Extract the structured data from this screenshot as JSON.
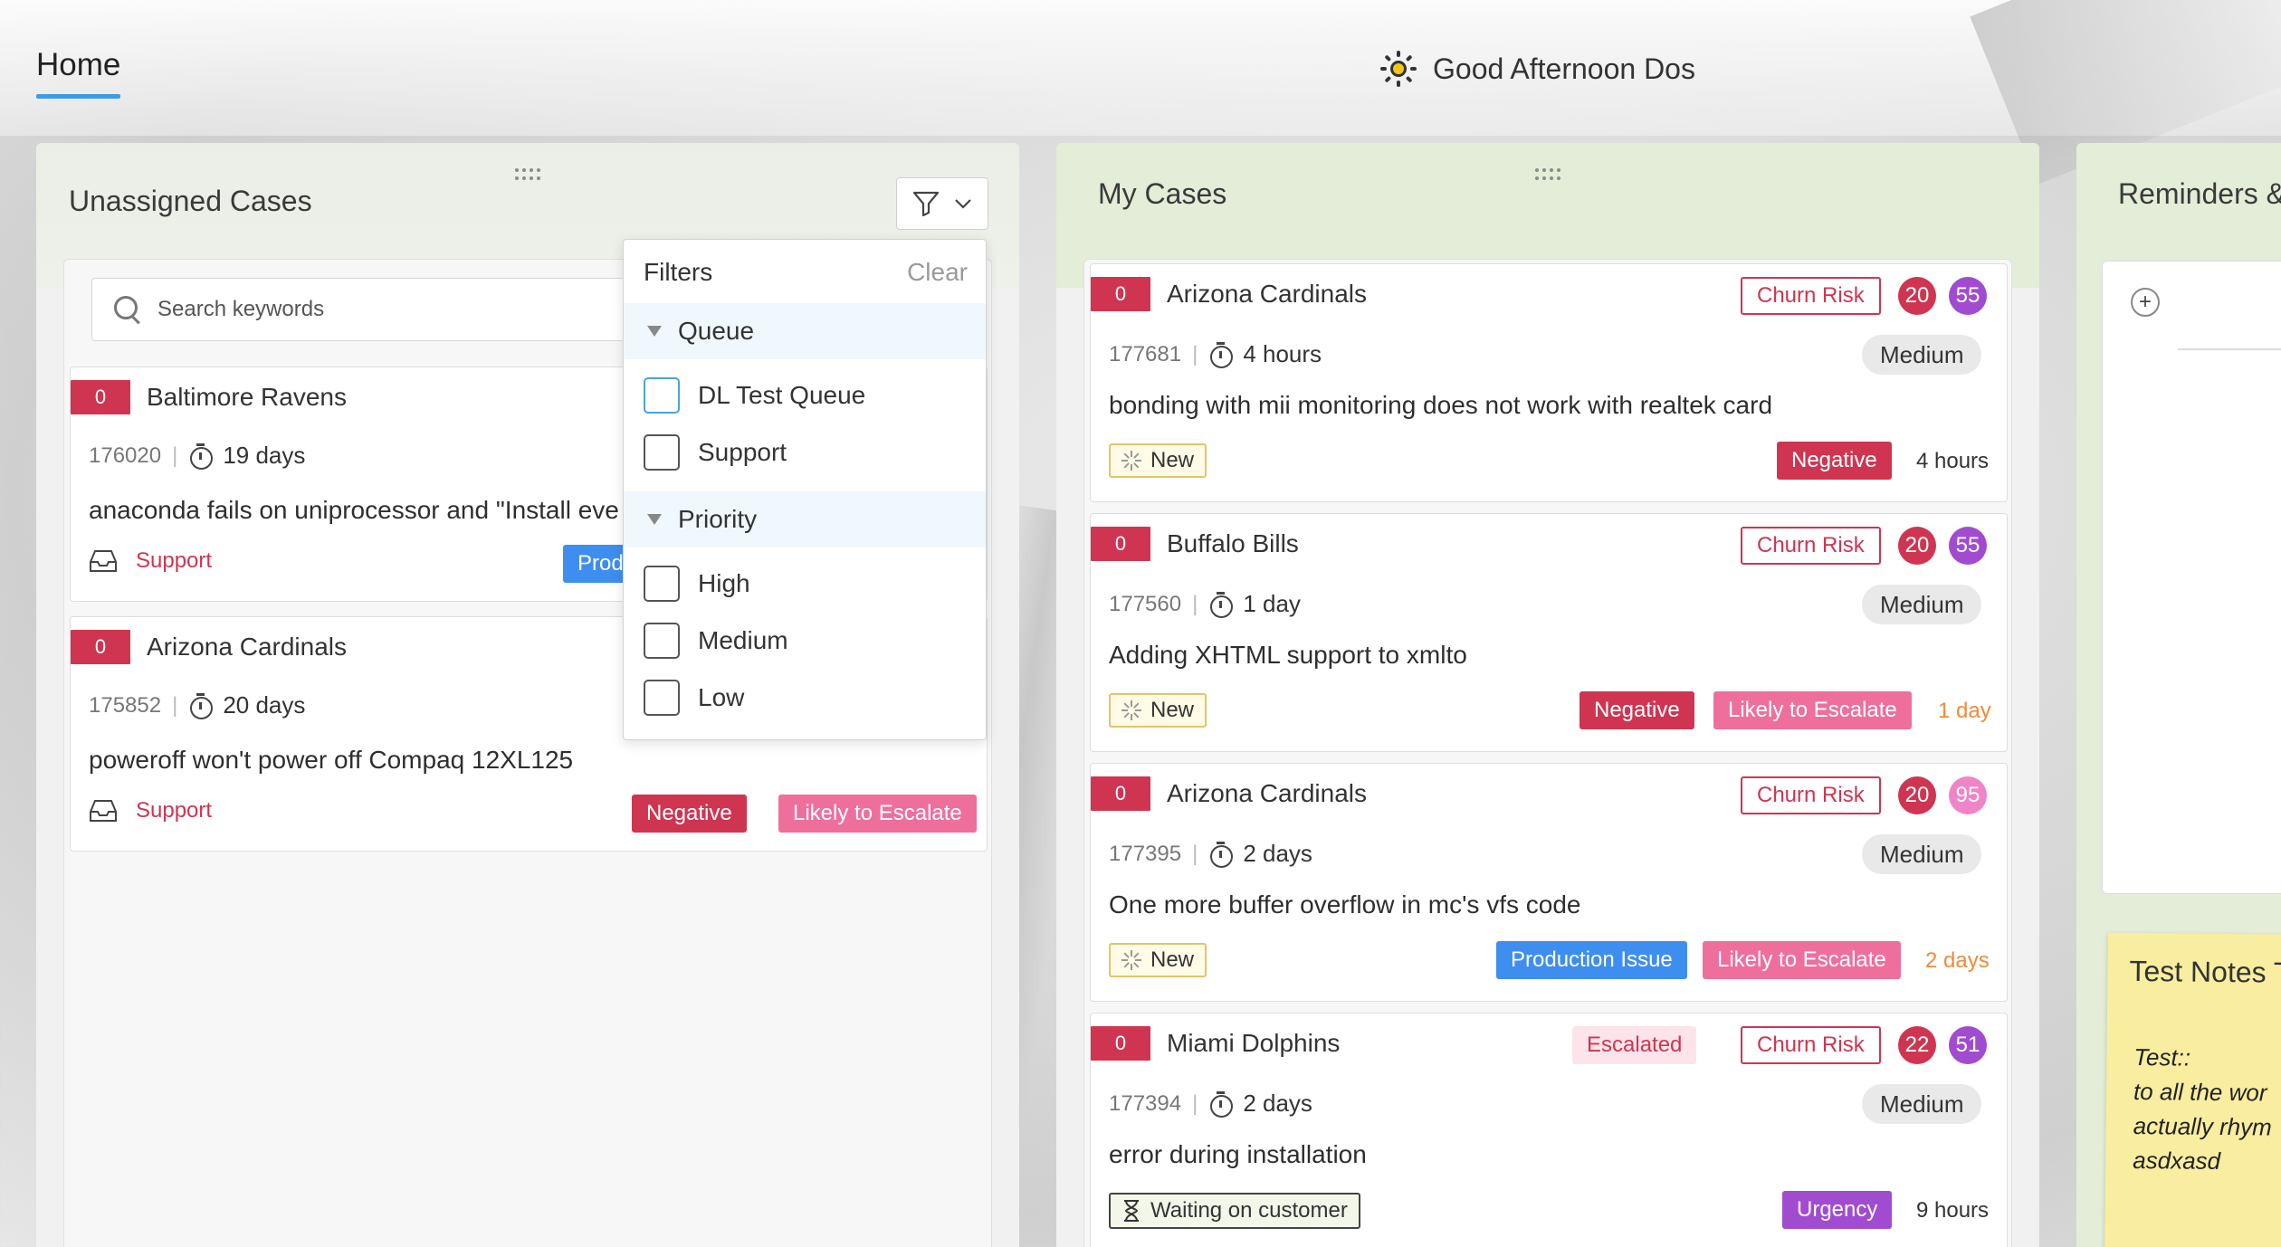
{
  "header": {
    "home_tab": "Home",
    "greeting": "Good Afternoon Dos"
  },
  "unassigned": {
    "title": "Unassigned Cases",
    "search_placeholder": "Search keywords",
    "cards": [
      {
        "count": "0",
        "account": "Baltimore Ravens",
        "case_id": "176020",
        "duration": "19 days",
        "description": "anaconda fails on uniprocessor and \"Install eve",
        "queue": "Support",
        "tag": "Prod"
      },
      {
        "count": "0",
        "account": "Arizona Cardinals",
        "case_id": "175852",
        "duration": "20 days",
        "description": "poweroff won't power off Compaq 12XL125",
        "queue": "Support",
        "tags": [
          "Negative",
          "Likely to Escalate"
        ]
      }
    ]
  },
  "filters": {
    "title": "Filters",
    "clear": "Clear",
    "groups": [
      {
        "label": "Queue",
        "options": [
          "DL Test Queue",
          "Support"
        ]
      },
      {
        "label": "Priority",
        "options": [
          "High",
          "Medium",
          "Low"
        ]
      }
    ]
  },
  "mycases": {
    "title": "My Cases",
    "cards": [
      {
        "count": "0",
        "account": "Arizona Cardinals",
        "case_id": "177681",
        "duration": "4 hours",
        "churn": "Churn Risk",
        "score1": "20",
        "score2": "55",
        "priority": "Medium",
        "description": "bonding with mii monitoring does not work with realtek card",
        "status": "New",
        "tags": [
          "Negative"
        ],
        "age": "4 hours"
      },
      {
        "count": "0",
        "account": "Buffalo Bills",
        "case_id": "177560",
        "duration": "1 day",
        "churn": "Churn Risk",
        "score1": "20",
        "score2": "55",
        "priority": "Medium",
        "description": "Adding XHTML support to xmlto",
        "status": "New",
        "tags": [
          "Negative",
          "Likely to Escalate"
        ],
        "age": "1 day"
      },
      {
        "count": "0",
        "account": "Arizona Cardinals",
        "case_id": "177395",
        "duration": "2 days",
        "churn": "Churn Risk",
        "score1": "20",
        "score2": "95",
        "priority": "Medium",
        "description": "One more buffer overflow in mc's vfs code",
        "status": "New",
        "tags": [
          "Production Issue",
          "Likely to Escalate"
        ],
        "age": "2 days"
      },
      {
        "count": "0",
        "account": "Miami Dolphins",
        "case_id": "177394",
        "duration": "2 days",
        "escalated": "Escalated",
        "churn": "Churn Risk",
        "score1": "22",
        "score2": "51",
        "priority": "Medium",
        "description": "error during installation",
        "status": "Waiting on customer",
        "tags": [
          "Urgency"
        ],
        "age": "9 hours"
      }
    ]
  },
  "reminders": {
    "title": "Reminders &",
    "add_symbol": "+"
  },
  "notes": {
    "title": "Test Notes T",
    "lines": [
      "Test::",
      "to all the wor",
      "actually rhym",
      "asdxasd"
    ]
  },
  "colors": {
    "accent_blue": "#3a9be6",
    "danger": "#cf3551",
    "escalate_pink": "#ef6f9c",
    "production_blue": "#3e8ef0",
    "urgency_purple": "#a14cd0",
    "panel_green": "#e4edd7",
    "note_yellow": "#f9eda0"
  }
}
